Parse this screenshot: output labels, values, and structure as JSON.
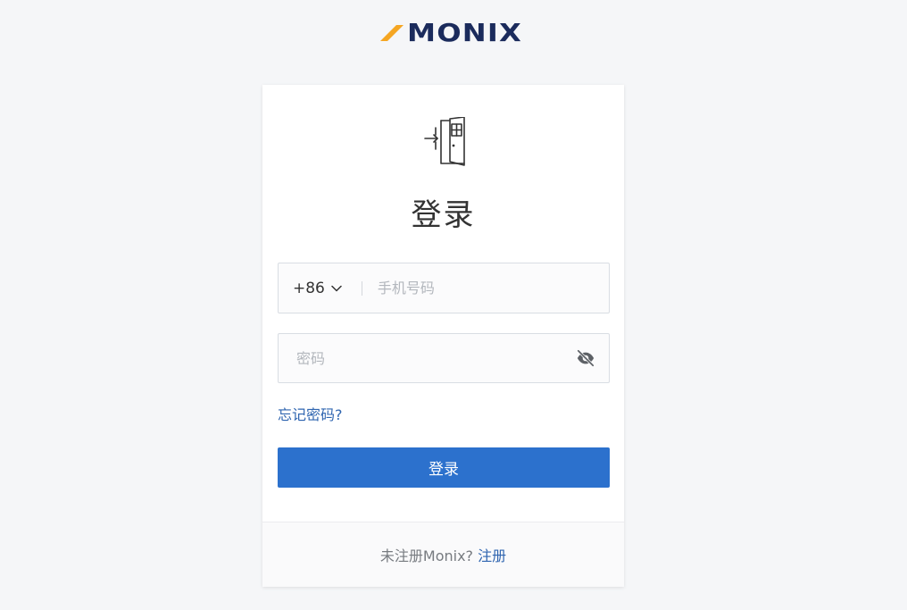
{
  "brand": {
    "logo_text": "MONIX",
    "accent_color": "#f5a623",
    "text_color": "#1b2b5c"
  },
  "login": {
    "icon": "door-enter-icon",
    "title": "登录",
    "phone": {
      "country_code": "+86",
      "placeholder": "手机号码",
      "value": ""
    },
    "password": {
      "placeholder": "密码",
      "value": "",
      "toggle_icon": "eye-off-icon"
    },
    "forgot_link": "忘记密码?",
    "submit_label": "登录",
    "primary_color": "#2c71cd",
    "link_color": "#2f65b0"
  },
  "footer": {
    "prompt": "未注册Monix?",
    "register_link": "注册"
  }
}
